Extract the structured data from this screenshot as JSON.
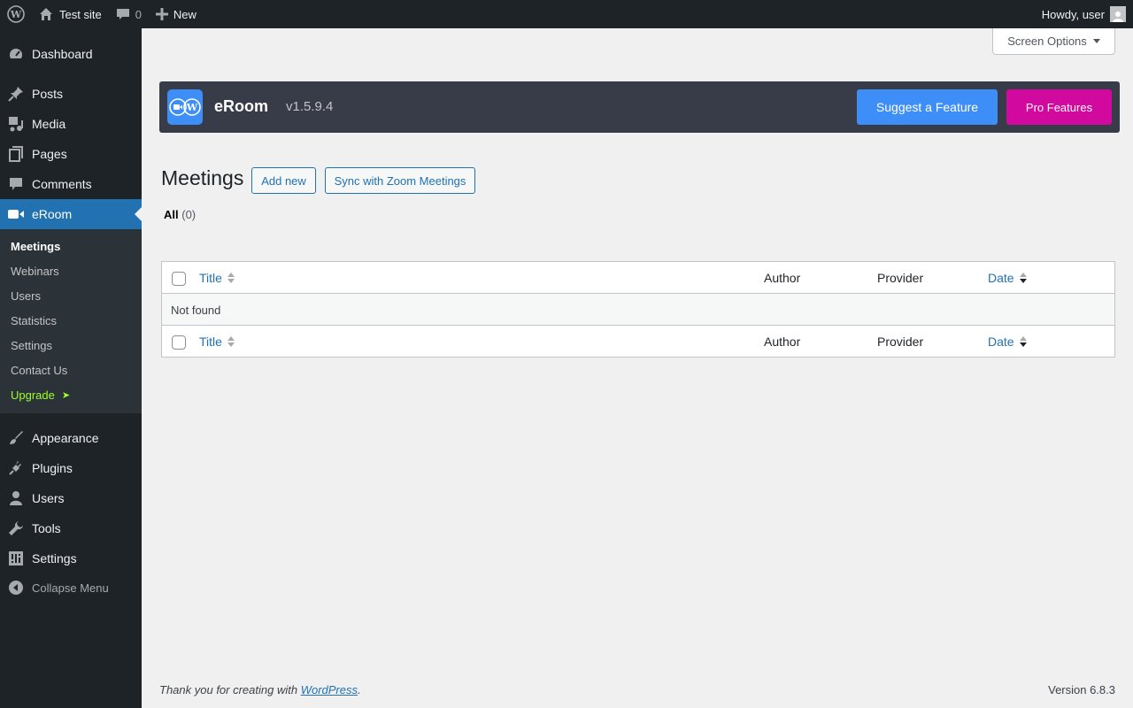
{
  "adminbar": {
    "site_name": "Test site",
    "comments_count": "0",
    "new_label": "New",
    "greeting": "Howdy, user"
  },
  "sidebar": {
    "items": [
      {
        "label": "Dashboard",
        "icon": "dashboard-icon"
      },
      {
        "label": "Posts",
        "icon": "pin-icon"
      },
      {
        "label": "Media",
        "icon": "media-icon"
      },
      {
        "label": "Pages",
        "icon": "pages-icon"
      },
      {
        "label": "Comments",
        "icon": "comment-icon"
      },
      {
        "label": "eRoom",
        "icon": "video-camera-icon"
      },
      {
        "label": "Appearance",
        "icon": "brush-icon"
      },
      {
        "label": "Plugins",
        "icon": "plug-icon"
      },
      {
        "label": "Users",
        "icon": "user-icon"
      },
      {
        "label": "Tools",
        "icon": "wrench-icon"
      },
      {
        "label": "Settings",
        "icon": "sliders-icon"
      }
    ],
    "submenu": [
      "Meetings",
      "Webinars",
      "Users",
      "Statistics",
      "Settings",
      "Contact Us"
    ],
    "upgrade_label": "Upgrade",
    "upgrade_arrow": "➤",
    "collapse_label": "Collapse Menu"
  },
  "screen_options": "Screen Options",
  "banner": {
    "brand": "eRoom",
    "version": "v1.5.9.4",
    "suggest_label": "Suggest a Feature",
    "pro_label": "Pro Features",
    "colors": {
      "background": "#383b48",
      "suggest": "#3e8ef7",
      "pro": "#d2099f"
    }
  },
  "page": {
    "title": "Meetings",
    "add_new": "Add new",
    "sync": "Sync with Zoom Meetings",
    "filter_all": "All",
    "filter_count": "(0)"
  },
  "table": {
    "columns": [
      "Title",
      "Author",
      "Provider",
      "Date"
    ],
    "empty_message": "Not found"
  },
  "footer": {
    "thanks_prefix": "Thank you for creating with ",
    "thanks_link": "WordPress",
    "thanks_suffix": ".",
    "version": "Version 6.8.3"
  },
  "colors": {
    "accent": "#2271b1",
    "menu_bg": "#1d2327",
    "submenu_bg": "#2c3338",
    "upgrade": "#9cff2e"
  }
}
